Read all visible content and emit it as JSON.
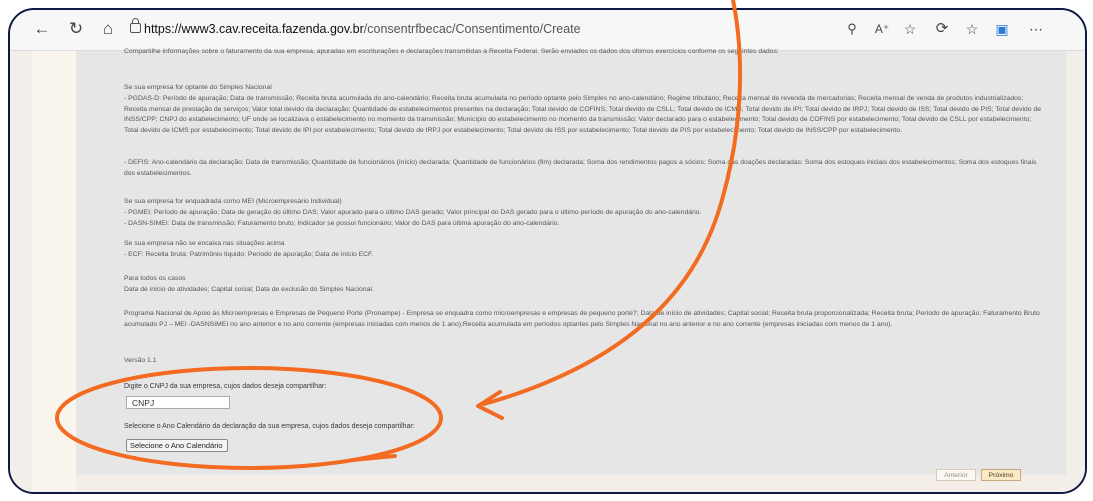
{
  "browser": {
    "url_host": "https://www3.cav.receita.fazenda.gov.br",
    "url_path": "/consentrfbecac/Consentimento/Create"
  },
  "page": {
    "intro_cut": "Compartilhe informações sobre o faturamento da sua empresa, apuradas em escriturações e declarações transmitidas à Receita Federal. Serão enviados os dados dos últimos exercícios conforme os seguintes dados:",
    "simples_title": "Se sua empresa for optante do Simples Nacional",
    "simples_pgdas": "- PGDAS-D: Período de apuração; Data de transmissão; Receita bruta acumulada do ano-calendário; Receita bruta acumulada no período optante pelo Simples no ano-calendário; Regime tributário; Receita mensal de revenda de mercadorias; Receita mensal de venda de produtos industrializados; Receita mensal de prestação de serviços; Valor total devido da declaração; Quantidade de estabelecimentos presentes na declaração; Total devido de COFINS; Total devido de CSLL; Total devido de ICMS; Total devido de IPI; Total devido de IRPJ; Total devido de ISS; Total devido de PIS; Total devido de INSS/CPP; CNPJ do estabelecimento; UF onde se localizava o estabelecimento no momento da transmissão; Município do estabelecimento no momento da transmissão; Valor declarado para o estabelecimento; Total devido de COFINS por estabelecimento; Total devido de CSLL por estabelecimento; Total devido de ICMS por estabelecimento; Total devido de IPI por estabelecimento; Total devido de IRPJ por estabelecimento; Total devido de ISS por estabelecimento; Total devido de PIS por estabelecimento; Total devido de INSS/CPP por estabelecimento.",
    "simples_defis": "- DEFIS: Ano-calendário da declaração; Data de transmissão; Quantidade de funcionários (início) declarada; Quantidade de funcionários (fim) declarada; Soma dos rendimentos pagos a sócios; Soma das doações declaradas; Soma dos estoques iniciais dos estabelecimentos; Soma dos estoques finais dos estabelecimentos.",
    "mei_title": "Se sua empresa for enquadrada como MEI (Microempresário Individual)",
    "mei_pgmei": "- PGMEI: Período de apuração; Data de geração do último DAS; Valor apurado para o último DAS gerado; Valor principal do DAS gerado para o último período de apuração do ano-calendário.",
    "mei_dasn": "- DASN-SIMEI: Data de transmissão; Faturamento bruto; Indicador se possui funcionário; Valor do DAS para última apuração do ano-calendário.",
    "none_title": "Se sua empresa não se encaixa nas situações acima",
    "none_ecf": "- ECF: Receita bruta; Patrimônio líquido; Período de apuração; Data de início ECF.",
    "all_title": "Para todos os casos",
    "all_text": "Data de início de atividades; Capital social; Data de exclusão do Simples Nacional.",
    "pronampe": "Programa Nacional de Apoio às Microempresas e Empresas de Pequeno Porte (Pronampe) - Empresa se enquadra como microempresas e empresas de pequeno porte?; Data de início de atividades; Capital social; Receita bruta proporcionalizada; Receita bruta; Período de apuração; Faturamento Bruto acumulado PJ – MEI -DASNSIMEI no ano anterior e no ano corrente (empresas iniciadas com menos de 1 ano);Receita acumulada em períodos optantes pelo Simples Nacional no ano anterior e no ano corrente (empresas iniciadas com menos de 1 ano).",
    "version": "Versão 1.1"
  },
  "form": {
    "cnpj_label": "Digite o CNPJ da sua empresa, cujos dados deseja compartilhar:",
    "cnpj_value": "CNPJ",
    "year_label": "Selecione o Ano Calendário da declaração da sua empresa, cujos dados deseja compartilhar:",
    "year_selected": "Selecione o Ano Calendário"
  },
  "buttons": {
    "previous": "Anterior",
    "next": "Próximo"
  },
  "icons": [
    "back-arrow-icon",
    "reload-icon",
    "home-icon",
    "lock-icon",
    "zoom-icon",
    "read-aloud-icon",
    "favorite-star-icon",
    "refresh-tracker-icon",
    "favorites-icon",
    "collections-icon",
    "more-icon"
  ],
  "colors": {
    "annotation": "#f26b21",
    "frame": "#0e1a44",
    "next_button_bg": "#f9e9c8"
  }
}
